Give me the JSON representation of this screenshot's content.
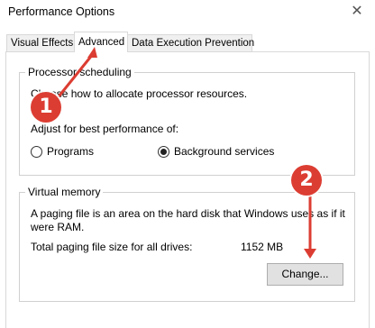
{
  "window": {
    "title": "Performance Options",
    "close_glyph": "✕"
  },
  "tabs": [
    {
      "label": "Visual Effects"
    },
    {
      "label": "Advanced"
    },
    {
      "label": "Data Execution Prevention"
    }
  ],
  "processor": {
    "group_title": "Processor scheduling",
    "description": "Choose how to allocate processor resources.",
    "adjust_label": "Adjust for best performance of:",
    "options": [
      {
        "label": "Programs",
        "selected": false
      },
      {
        "label": "Background services",
        "selected": true
      }
    ]
  },
  "virtual_memory": {
    "group_title": "Virtual memory",
    "description_line1": "A paging file is an area on the hard disk that Windows uses as if it",
    "description_line2": "were RAM.",
    "total_label": "Total paging file size for all drives:",
    "total_value": "1152 MB",
    "change_button": "Change..."
  },
  "annotations": [
    {
      "number": "1",
      "color": "#dc3d32"
    },
    {
      "number": "2",
      "color": "#dc3d32"
    }
  ]
}
